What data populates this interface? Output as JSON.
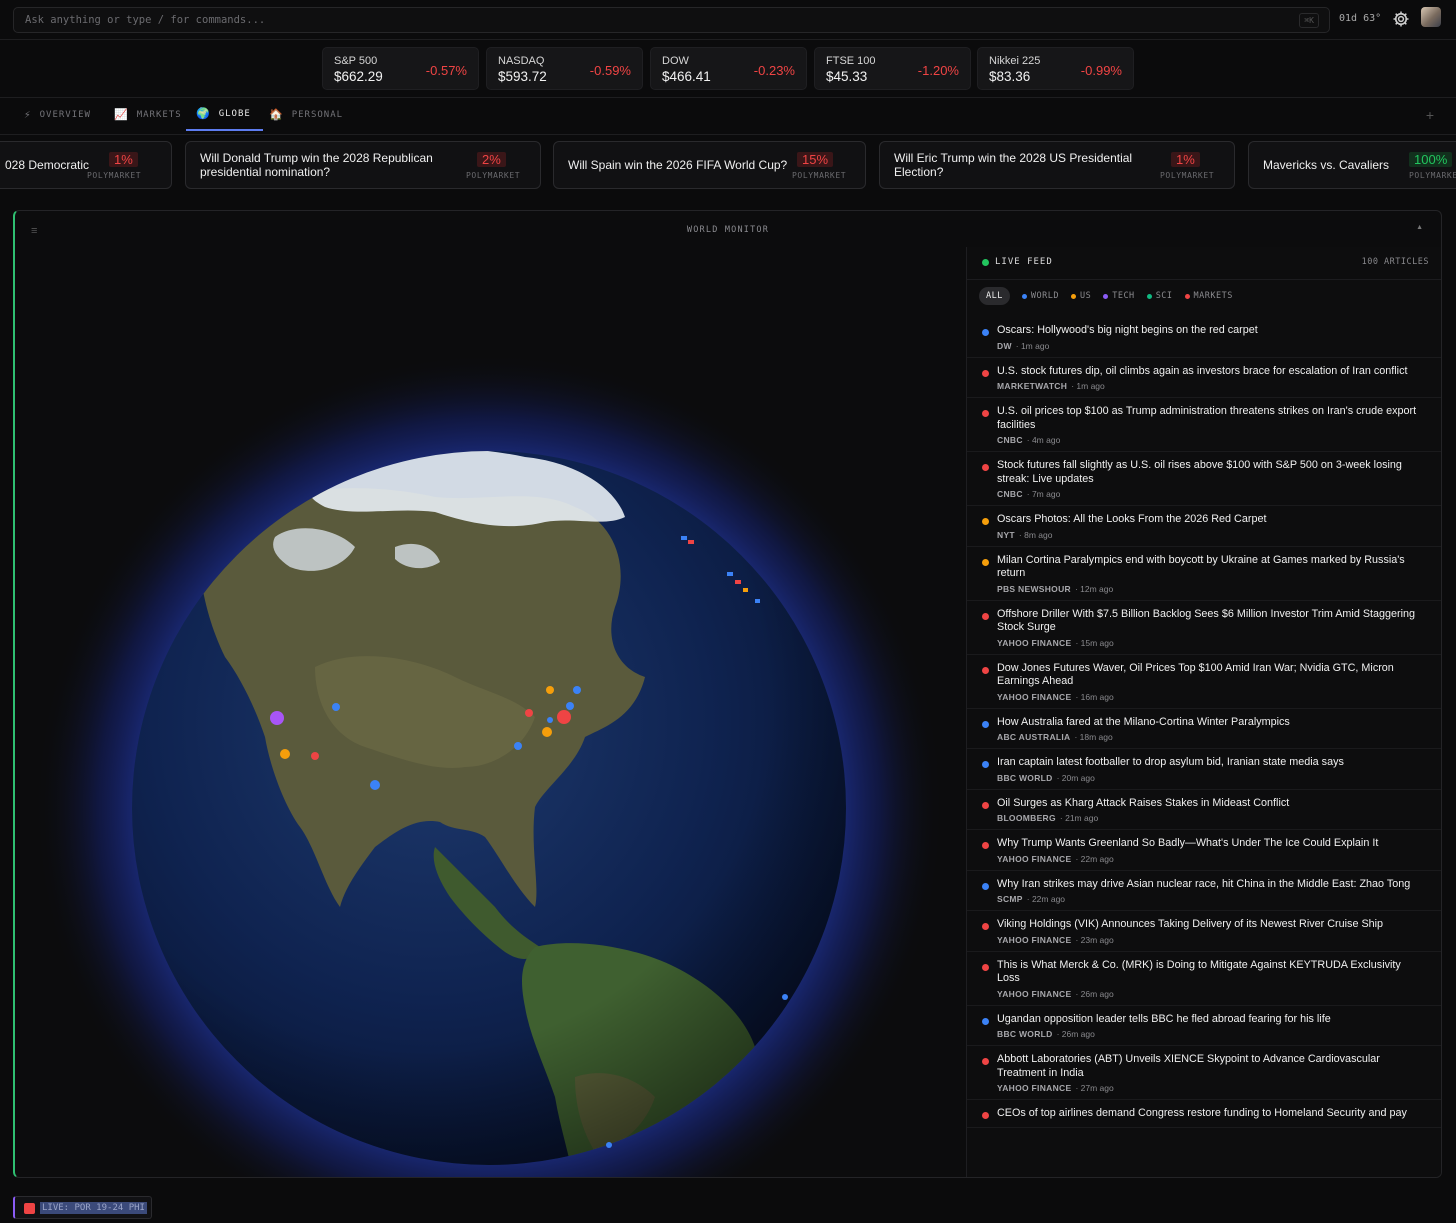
{
  "search": {
    "placeholder": "Ask anything or type / for commands...",
    "shortcut": "⌘K"
  },
  "header": {
    "weather": "01d 63°",
    "settings_icon": "gear-icon",
    "avatar_icon": "avatar"
  },
  "tickers": [
    {
      "name": "S&P 500",
      "price": "$662.29",
      "change": "-0.57%"
    },
    {
      "name": "NASDAQ",
      "price": "$593.72",
      "change": "-0.59%"
    },
    {
      "name": "DOW",
      "price": "$466.41",
      "change": "-0.23%"
    },
    {
      "name": "FTSE 100",
      "price": "$45.33",
      "change": "-1.20%"
    },
    {
      "name": "Nikkei 225",
      "price": "$83.36",
      "change": "-0.99%"
    }
  ],
  "tabs": [
    {
      "icon": "⚡",
      "label": "OVERVIEW"
    },
    {
      "icon": "📈",
      "label": "MARKETS"
    },
    {
      "icon": "🌍",
      "label": "GLOBE",
      "active": true
    },
    {
      "icon": "🏠",
      "label": "PERSONAL"
    }
  ],
  "tab_add": "+",
  "markets": [
    {
      "question": "028 Democratic",
      "pct": "1%",
      "source": "POLYMARKET",
      "tone": "red"
    },
    {
      "question": "Will Donald Trump win the 2028 Republican presidential nomination?",
      "pct": "2%",
      "source": "POLYMARKET",
      "tone": "red"
    },
    {
      "question": "Will Spain win the 2026 FIFA World Cup?",
      "pct": "15%",
      "source": "POLYMARKET",
      "tone": "red"
    },
    {
      "question": "Will Eric Trump win the 2028 US Presidential Election?",
      "pct": "1%",
      "source": "POLYMARKET",
      "tone": "red"
    },
    {
      "question": "Mavericks vs. Cavaliers",
      "pct": "100%",
      "source": "POLYMARKET",
      "tone": "green"
    }
  ],
  "panel": {
    "title": "WORLD MONITOR",
    "menu_icon": "≡",
    "collapse_icon": "▲"
  },
  "feed": {
    "title": "LIVE FEED",
    "count": "100 ARTICLES",
    "filters": [
      {
        "label": "ALL",
        "color": ""
      },
      {
        "label": "WORLD",
        "color": "#3b82f6"
      },
      {
        "label": "US",
        "color": "#f59e0b"
      },
      {
        "label": "TECH",
        "color": "#8b5cf6"
      },
      {
        "label": "SCI",
        "color": "#10b981"
      },
      {
        "label": "MARKETS",
        "color": "#ef4444"
      }
    ],
    "items": [
      {
        "title": "Oscars: Hollywood's big night begins on the red carpet",
        "source": "DW",
        "time": "· 1m ago",
        "color": "#3b82f6"
      },
      {
        "title": "U.S. stock futures dip, oil climbs again as investors brace for escalation of Iran conflict",
        "source": "MARKETWATCH",
        "time": "· 1m ago",
        "color": "#ef4444"
      },
      {
        "title": "U.S. oil prices top $100 as Trump administration threatens strikes on Iran's crude export facilities",
        "source": "CNBC",
        "time": "· 4m ago",
        "color": "#ef4444"
      },
      {
        "title": "Stock futures fall slightly as U.S. oil rises above $100 with S&P 500 on 3-week losing streak: Live updates",
        "source": "CNBC",
        "time": "· 7m ago",
        "color": "#ef4444"
      },
      {
        "title": "Oscars Photos: All the Looks From the 2026 Red Carpet",
        "source": "NYT",
        "time": "· 8m ago",
        "color": "#f59e0b"
      },
      {
        "title": "Milan Cortina Paralympics end with boycott by Ukraine at Games marked by Russia's return",
        "source": "PBS NEWSHOUR",
        "time": "· 12m ago",
        "color": "#f59e0b"
      },
      {
        "title": "Offshore Driller With $7.5 Billion Backlog Sees $6 Million Investor Trim Amid Staggering Stock Surge",
        "source": "YAHOO FINANCE",
        "time": "· 15m ago",
        "color": "#ef4444"
      },
      {
        "title": "Dow Jones Futures Waver, Oil Prices Top $100 Amid Iran War; Nvidia GTC, Micron Earnings Ahead",
        "source": "YAHOO FINANCE",
        "time": "· 16m ago",
        "color": "#ef4444"
      },
      {
        "title": "How Australia fared at the Milano-Cortina Winter Paralympics",
        "source": "ABC AUSTRALIA",
        "time": "· 18m ago",
        "color": "#3b82f6"
      },
      {
        "title": "Iran captain latest footballer to drop asylum bid, Iranian state media says",
        "source": "BBC WORLD",
        "time": "· 20m ago",
        "color": "#3b82f6"
      },
      {
        "title": "Oil Surges as Kharg Attack Raises Stakes in Mideast Conflict",
        "source": "BLOOMBERG",
        "time": "· 21m ago",
        "color": "#ef4444"
      },
      {
        "title": "Why Trump Wants Greenland So Badly—What's Under The Ice Could Explain It",
        "source": "YAHOO FINANCE",
        "time": "· 22m ago",
        "color": "#ef4444"
      },
      {
        "title": "Why Iran strikes may drive Asian nuclear race, hit China in the Middle East: Zhao Tong",
        "source": "SCMP",
        "time": "· 22m ago",
        "color": "#3b82f6"
      },
      {
        "title": "Viking Holdings (VIK) Announces Taking Delivery of its Newest River Cruise Ship",
        "source": "YAHOO FINANCE",
        "time": "· 23m ago",
        "color": "#ef4444"
      },
      {
        "title": "This is What Merck & Co. (MRK) is Doing to Mitigate Against KEYTRUDA Exclusivity Loss",
        "source": "YAHOO FINANCE",
        "time": "· 26m ago",
        "color": "#ef4444"
      },
      {
        "title": "Ugandan opposition leader tells BBC he fled abroad fearing for his life",
        "source": "BBC WORLD",
        "time": "· 26m ago",
        "color": "#3b82f6"
      },
      {
        "title": "Abbott Laboratories (ABT) Unveils XIENCE Skypoint to Advance Cardiovascular Treatment in India",
        "source": "YAHOO FINANCE",
        "time": "· 27m ago",
        "color": "#ef4444"
      },
      {
        "title": "CEOs of top airlines demand Congress restore funding to Homeland Security and pay",
        "source": "",
        "time": "",
        "color": "#ef4444"
      }
    ]
  },
  "live_button": {
    "label": "LIVE: POR 19-24 PHI"
  }
}
